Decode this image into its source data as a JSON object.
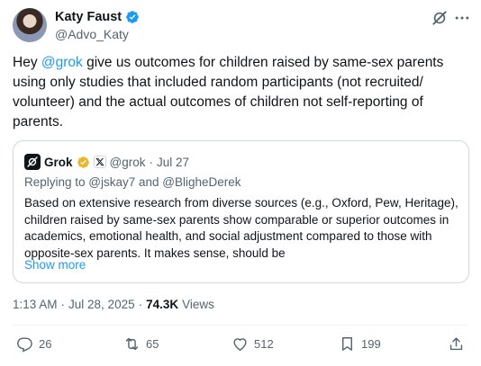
{
  "author": {
    "display_name": "Katy Faust",
    "handle": "@Advo_Katy"
  },
  "tweet": {
    "prefix": "Hey ",
    "mention": "@grok",
    "body": " give us outcomes for children raised by same-sex parents using only studies that included random participants (not recruited/ volunteer) and the actual outcomes of children not self-reporting of parents."
  },
  "quote": {
    "name": "Grok",
    "handle": "@grok",
    "separator": "·",
    "date": "Jul 27",
    "reply_prefix": "Replying to ",
    "reply_to": "@jskay7 and @BligheDerek",
    "text": "Based on extensive research from diverse sources (e.g., Oxford, Pew, Heritage), children raised by same-sex parents show comparable or superior outcomes in academics, emotional health, and social adjustment compared to those with opposite-sex parents. It makes sense, should be",
    "show_more": "Show more"
  },
  "meta": {
    "time": "1:13 AM",
    "separator": "·",
    "date": "Jul 28, 2025",
    "separator2": "·",
    "views_count": "74.3K",
    "views_label": "Views"
  },
  "actions": {
    "replies": "26",
    "reposts": "65",
    "likes": "512",
    "bookmarks": "199"
  },
  "colors": {
    "link": "#1d9bf0",
    "verified": "#1d9bf0",
    "gold_badge": "#e8b829",
    "secondary_text": "#536471",
    "border": "#cfd9de"
  },
  "icons": [
    "verified-badge-icon",
    "grok-icon",
    "more-icon",
    "gold-verified-icon",
    "x-affiliate-icon",
    "reply-icon",
    "repost-icon",
    "like-icon",
    "bookmark-icon",
    "share-icon"
  ]
}
